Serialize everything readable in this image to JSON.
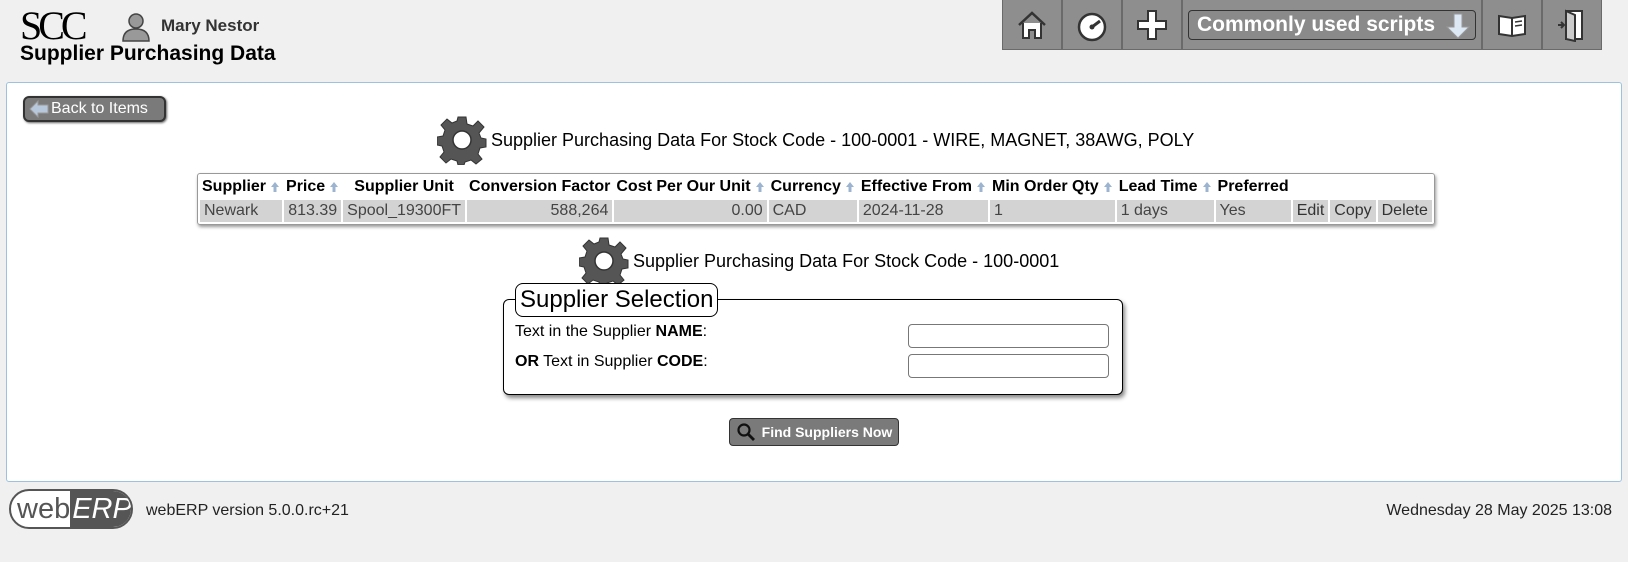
{
  "header": {
    "logo_text": "SCC",
    "user_name": "Mary Nestor",
    "page_title": "Supplier Purchasing Data"
  },
  "topnav": {
    "scripts_label": "Commonly used scripts"
  },
  "main": {
    "back_label": "Back to Items",
    "heading1": "Supplier Purchasing Data For Stock Code - 100-0001 - WIRE, MAGNET, 38AWG, POLY",
    "heading2": "Supplier Purchasing Data For Stock Code - 100-0001",
    "table": {
      "headers": [
        "Supplier",
        "Price",
        "Supplier Unit",
        "Conversion Factor",
        "Cost Per Our Unit",
        "Currency",
        "Effective From",
        "Min Order Qty",
        "Lead Time",
        "Preferred"
      ],
      "rows": [
        {
          "supplier": "Newark",
          "price": "813.39",
          "supplier_unit": "Spool_19300FT",
          "conversion_factor": "588,264",
          "cost_per_unit": "0.00",
          "currency": "CAD",
          "effective_from": "2024-11-28",
          "min_order_qty": "1",
          "lead_time": "1 days",
          "preferred": "Yes",
          "edit": "Edit",
          "copy": "Copy",
          "delete": "Delete"
        }
      ]
    },
    "supplier_selection": {
      "legend": "Supplier Selection",
      "name_label_pre": "Text in the Supplier ",
      "name_label_bold": "NAME",
      "name_label_post": ":",
      "code_label_or": "OR",
      "code_label_mid": " Text in Supplier ",
      "code_label_bold": "CODE",
      "code_label_post": ":",
      "name_value": "",
      "code_value": ""
    },
    "find_label": "Find Suppliers Now"
  },
  "footer": {
    "logo_web": "web",
    "logo_erp": "ERP",
    "version": "webERP version 5.0.0.rc+21",
    "datetime": "Wednesday 28 May 2025 13:08"
  },
  "colors": {
    "nav_bg": "#8e8e8e",
    "button_bg": "#7a7a7a",
    "cell_bg": "#d3d3d3",
    "panel_border": "#9cc2e0"
  }
}
